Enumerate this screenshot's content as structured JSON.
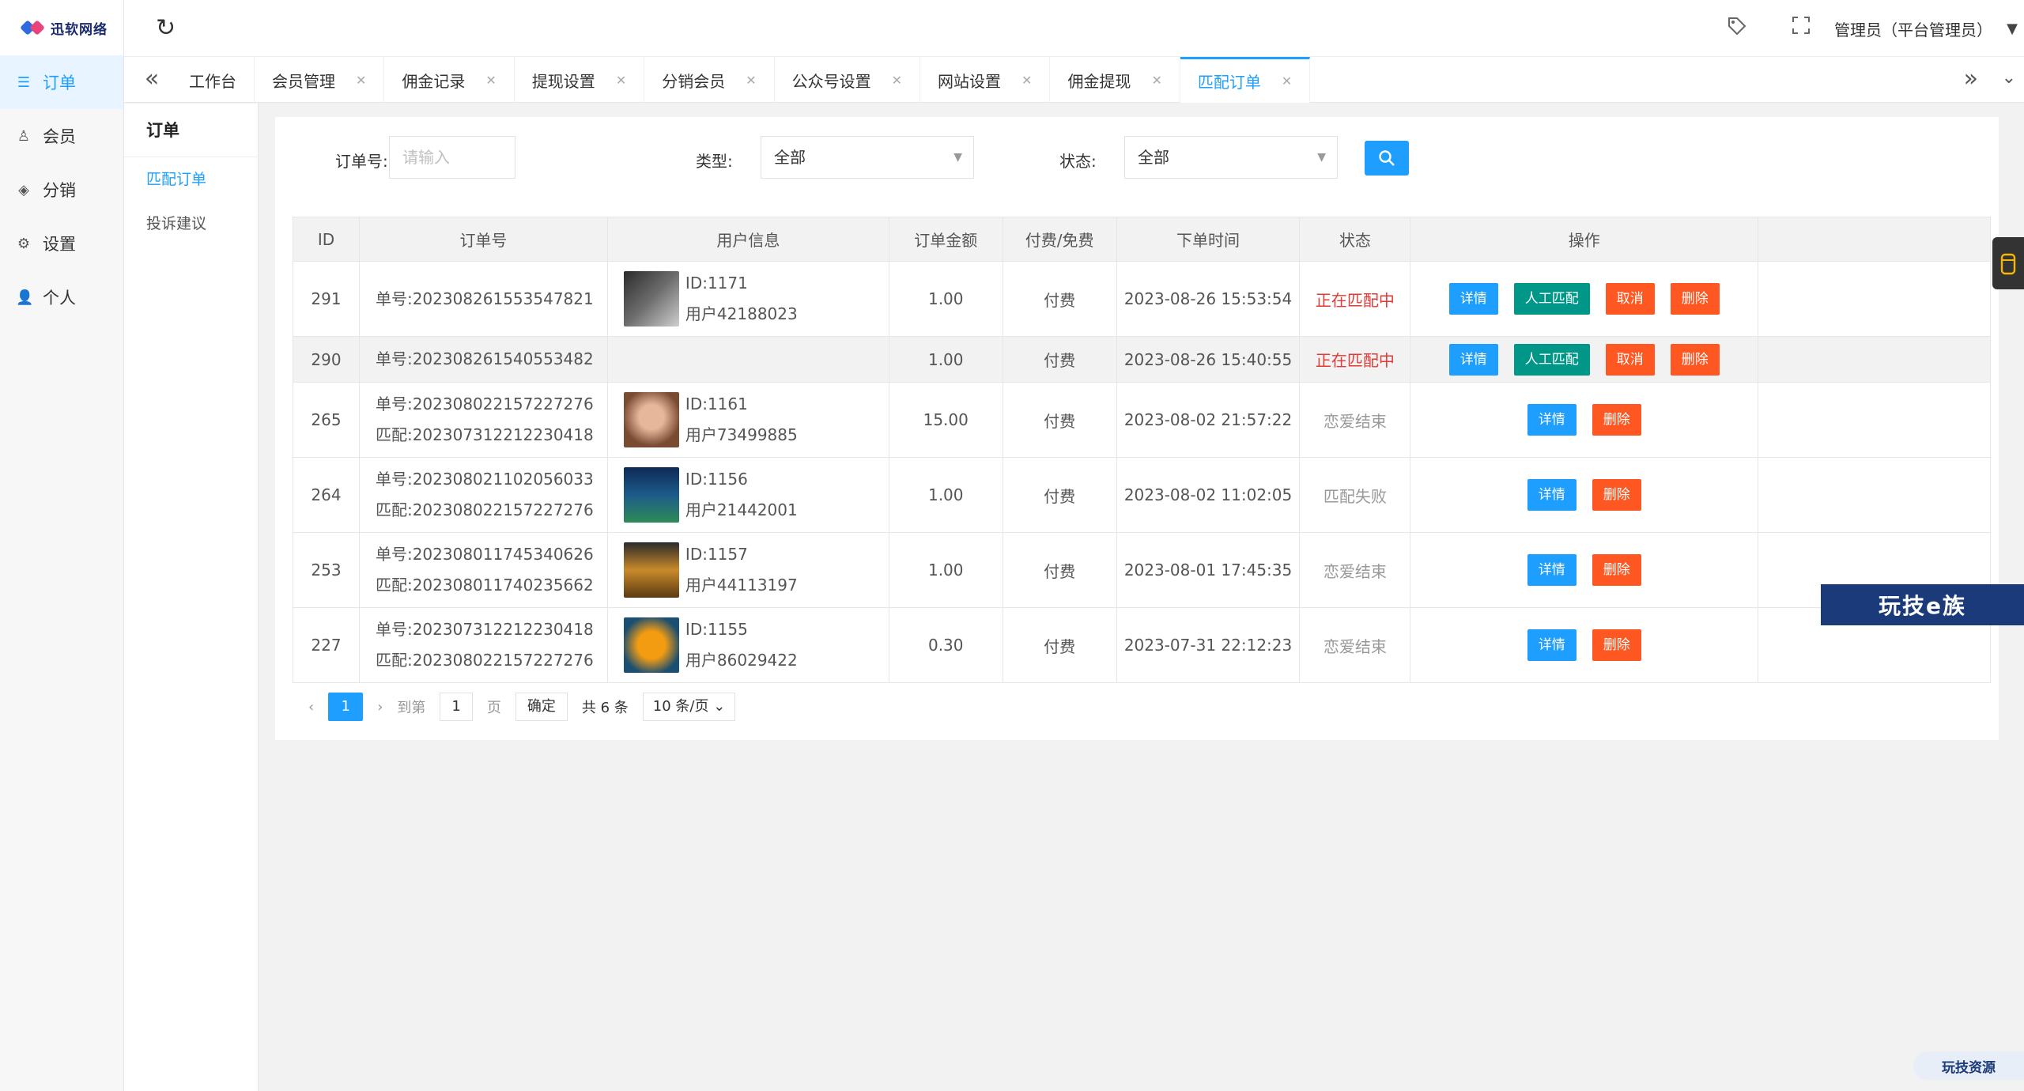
{
  "logo": {
    "text": "迅软网络"
  },
  "sidebar": {
    "items": [
      {
        "label": "订单",
        "icon": "list-icon",
        "active": true
      },
      {
        "label": "会员",
        "icon": "user-icon"
      },
      {
        "label": "分销",
        "icon": "layers-icon"
      },
      {
        "label": "设置",
        "icon": "gear-icon"
      },
      {
        "label": "个人",
        "icon": "person-icon"
      }
    ]
  },
  "header": {
    "user": "管理员（平台管理员）"
  },
  "tabs": [
    {
      "label": "工作台"
    },
    {
      "label": "会员管理"
    },
    {
      "label": "佣金记录"
    },
    {
      "label": "提现设置"
    },
    {
      "label": "分销会员"
    },
    {
      "label": "公众号设置"
    },
    {
      "label": "网站设置"
    },
    {
      "label": "佣金提现"
    },
    {
      "label": "匹配订单",
      "active": true
    }
  ],
  "subnav": {
    "title": "订单",
    "items": [
      "匹配订单",
      "投诉建议"
    ]
  },
  "filters": {
    "order_label": "订单号:",
    "order_placeholder": "请输入",
    "type_label": "类型:",
    "type_value": "全部",
    "status_label": "状态:",
    "status_value": "全部"
  },
  "table": {
    "headers": [
      "ID",
      "订单号",
      "用户信息",
      "订单金额",
      "付费/免费",
      "下单时间",
      "状态",
      "操作"
    ],
    "rows": [
      {
        "id": "291",
        "order": [
          "单号:202308261553547821"
        ],
        "user_id": "ID:1171",
        "user_name": "用户42188023",
        "amount": "1.00",
        "pay": "付费",
        "time": "2023-08-26 15:53:54",
        "status": "正在匹配中",
        "status_color": "#e53935",
        "ops": [
          "详情",
          "人工匹配",
          "取消",
          "删除"
        ]
      },
      {
        "id": "290",
        "order": [
          "单号:202308261540553482"
        ],
        "user_id": "",
        "user_name": "",
        "amount": "1.00",
        "pay": "付费",
        "time": "2023-08-26 15:40:55",
        "status": "正在匹配中",
        "status_color": "#e53935",
        "ops": [
          "详情",
          "人工匹配",
          "取消",
          "删除"
        ]
      },
      {
        "id": "265",
        "order": [
          "单号:202308022157227276",
          "匹配:202307312212230418"
        ],
        "user_id": "ID:1161",
        "user_name": "用户73499885",
        "amount": "15.00",
        "pay": "付费",
        "time": "2023-08-02 21:57:22",
        "status": "恋爱结束",
        "status_color": "#999999",
        "ops": [
          "详情",
          "删除"
        ]
      },
      {
        "id": "264",
        "order": [
          "单号:202308021102056033",
          "匹配:202308022157227276"
        ],
        "user_id": "ID:1156",
        "user_name": "用户21442001",
        "amount": "1.00",
        "pay": "付费",
        "time": "2023-08-02 11:02:05",
        "status": "匹配失败",
        "status_color": "#999999",
        "ops": [
          "详情",
          "删除"
        ]
      },
      {
        "id": "253",
        "order": [
          "单号:202308011745340626",
          "匹配:202308011740235662"
        ],
        "user_id": "ID:1157",
        "user_name": "用户44113197",
        "amount": "1.00",
        "pay": "付费",
        "time": "2023-08-01 17:45:35",
        "status": "恋爱结束",
        "status_color": "#999999",
        "ops": [
          "详情",
          "删除"
        ]
      },
      {
        "id": "227",
        "order": [
          "单号:202307312212230418",
          "匹配:202308022157227276"
        ],
        "user_id": "ID:1155",
        "user_name": "用户86029422",
        "amount": "0.30",
        "pay": "付费",
        "time": "2023-07-31 22:12:23",
        "status": "恋爱结束",
        "status_color": "#999999",
        "ops": [
          "详情",
          "删除"
        ]
      }
    ]
  },
  "pager": {
    "current": "1",
    "goto": "到第",
    "input": "1",
    "page": "页",
    "confirm": "确定",
    "total": "共 6 条",
    "per_page": "10 条/页"
  },
  "watermarks": {
    "banner": "玩技e族",
    "corner": "玩技资源"
  },
  "colors": {
    "accent": "#1e9fff",
    "green": "#009688",
    "orange": "#ff5722",
    "red": "#e53935"
  }
}
